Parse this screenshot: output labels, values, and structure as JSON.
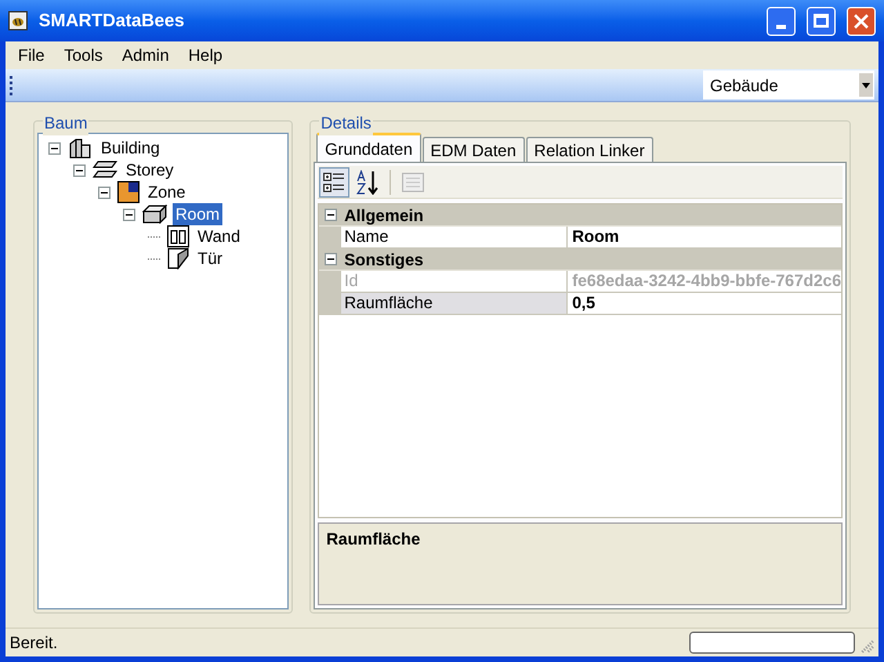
{
  "window": {
    "title": "SMARTDataBees"
  },
  "menu": [
    "File",
    "Tools",
    "Admin",
    "Help"
  ],
  "toolbar": {
    "dropdown": {
      "value": "Gebäude"
    }
  },
  "tree_panel": {
    "title": "Baum",
    "items": [
      {
        "label": "Building",
        "kind": "building",
        "expanded": true,
        "selected": false,
        "children": [
          {
            "label": "Storey",
            "kind": "storey",
            "expanded": true,
            "selected": false,
            "children": [
              {
                "label": "Zone",
                "kind": "zone",
                "expanded": true,
                "selected": false,
                "children": [
                  {
                    "label": "Room",
                    "kind": "room",
                    "expanded": true,
                    "selected": true,
                    "children": [
                      {
                        "label": "Wand",
                        "kind": "wall",
                        "selected": false
                      },
                      {
                        "label": "Tür",
                        "kind": "door",
                        "selected": false
                      }
                    ]
                  }
                ]
              }
            ]
          }
        ]
      }
    ]
  },
  "details_panel": {
    "title": "Details",
    "tabs": [
      {
        "label": "Grunddaten",
        "selected": true
      },
      {
        "label": "EDM Daten",
        "selected": false
      },
      {
        "label": "Relation Linker",
        "selected": false
      }
    ],
    "property_grid": {
      "categories": [
        {
          "label": "Allgemein",
          "expanded": true,
          "rows": [
            {
              "name": "Name",
              "value": "Room",
              "disabled": false,
              "selected": false
            }
          ]
        },
        {
          "label": "Sonstiges",
          "expanded": true,
          "rows": [
            {
              "name": "Id",
              "value": "fe68edaa-3242-4bb9-bbfe-767d2c6",
              "disabled": true,
              "selected": false
            },
            {
              "name": "Raumfläche",
              "value": "0,5",
              "disabled": false,
              "selected": true
            }
          ]
        }
      ]
    },
    "description": {
      "title": "Raumfläche"
    }
  },
  "status_bar": {
    "text": "Bereit.",
    "progress": {
      "level": 0
    }
  }
}
